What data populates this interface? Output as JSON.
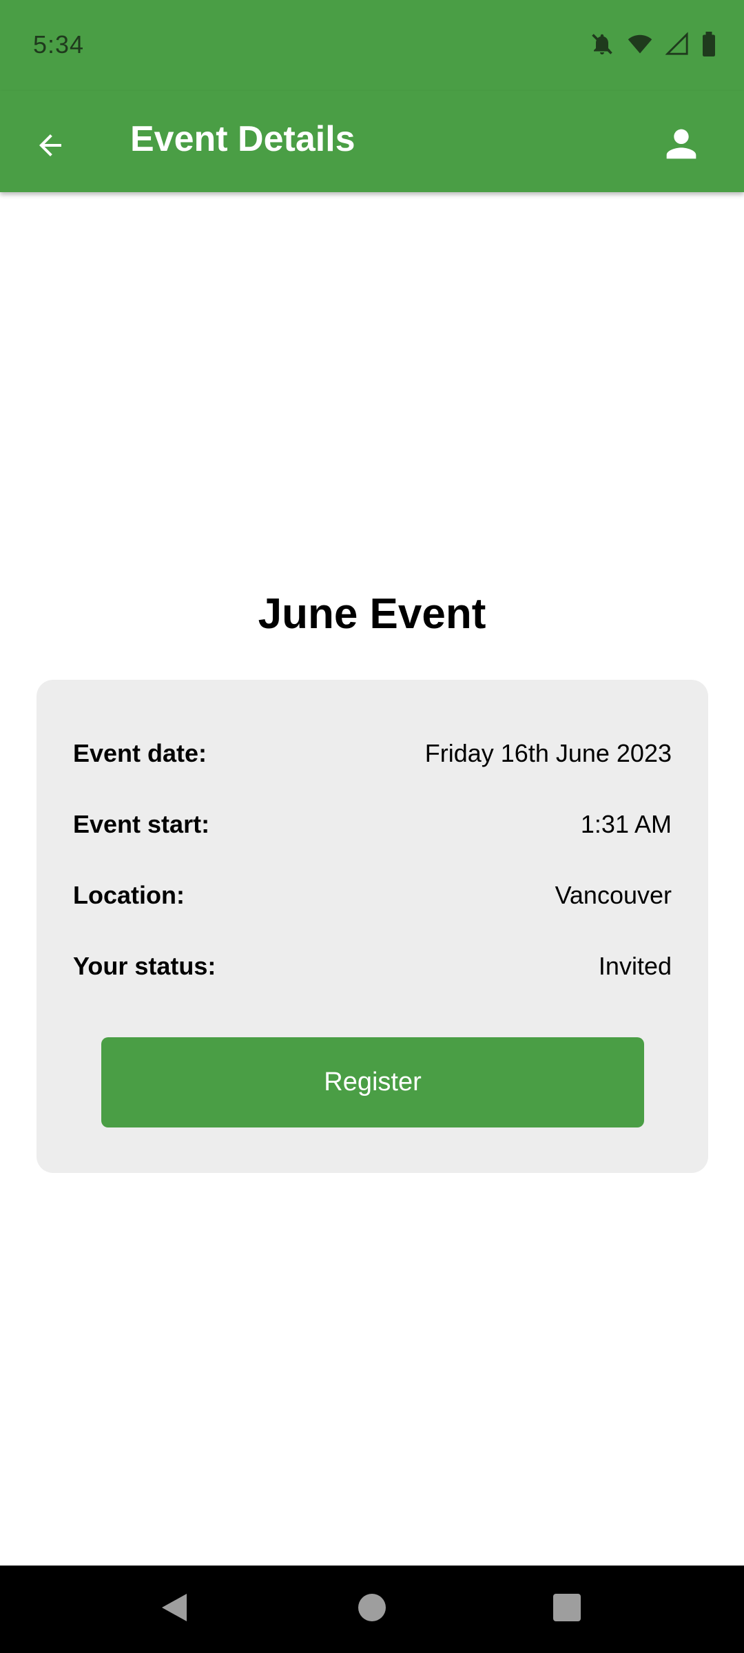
{
  "status_bar": {
    "time": "5:34",
    "icons": [
      "notifications-off-icon",
      "wifi-icon",
      "cell-signal-icon",
      "battery-icon"
    ]
  },
  "app_bar": {
    "title": "Event Details",
    "back_icon": "arrow-back-icon",
    "profile_icon": "person-icon",
    "color": "#4a9e45"
  },
  "event": {
    "title": "June Event",
    "details": [
      {
        "label": "Event date:",
        "value": "Friday 16th June 2023"
      },
      {
        "label": "Event start:",
        "value": "1:31 AM"
      },
      {
        "label": "Location:",
        "value": "Vancouver"
      },
      {
        "label": "Your status:",
        "value": "Invited"
      }
    ],
    "register_label": "Register"
  },
  "nav_bar": {
    "items": [
      "back-icon",
      "home-icon",
      "recents-icon"
    ]
  }
}
